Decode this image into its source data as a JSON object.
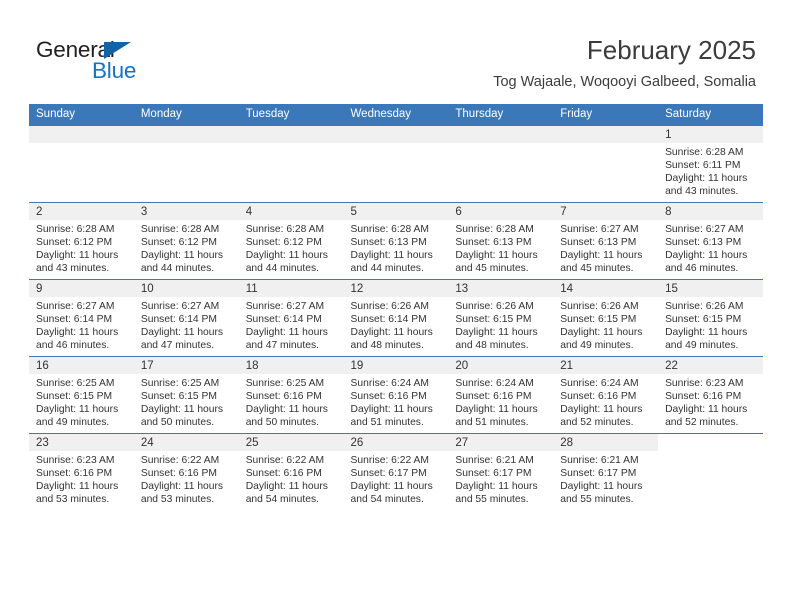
{
  "logo": {
    "word_top": "General",
    "word_bottom": "Blue",
    "triangle_color": "#1464a5",
    "text_color": "#231f20",
    "blue_color": "#1474c4"
  },
  "header": {
    "title": "February 2025",
    "subtitle": "Tog Wajaale, Woqooyi Galbeed, Somalia"
  },
  "theme": {
    "header_blue": "#3b78ba",
    "daynum_band": "#f0f0f0",
    "text": "#333333"
  },
  "weekdays": [
    "Sunday",
    "Monday",
    "Tuesday",
    "Wednesday",
    "Thursday",
    "Friday",
    "Saturday"
  ],
  "weeks": [
    [
      {
        "day": "",
        "blank": true,
        "band": true
      },
      {
        "day": "",
        "blank": true,
        "band": true
      },
      {
        "day": "",
        "blank": true,
        "band": true
      },
      {
        "day": "",
        "blank": true,
        "band": true
      },
      {
        "day": "",
        "blank": true,
        "band": true
      },
      {
        "day": "",
        "blank": true,
        "band": true
      },
      {
        "day": "1",
        "sunrise": "Sunrise: 6:28 AM",
        "sunset": "Sunset: 6:11 PM",
        "daylight_1": "Daylight: 11 hours",
        "daylight_2": "and 43 minutes."
      }
    ],
    [
      {
        "day": "2",
        "sunrise": "Sunrise: 6:28 AM",
        "sunset": "Sunset: 6:12 PM",
        "daylight_1": "Daylight: 11 hours",
        "daylight_2": "and 43 minutes."
      },
      {
        "day": "3",
        "sunrise": "Sunrise: 6:28 AM",
        "sunset": "Sunset: 6:12 PM",
        "daylight_1": "Daylight: 11 hours",
        "daylight_2": "and 44 minutes."
      },
      {
        "day": "4",
        "sunrise": "Sunrise: 6:28 AM",
        "sunset": "Sunset: 6:12 PM",
        "daylight_1": "Daylight: 11 hours",
        "daylight_2": "and 44 minutes."
      },
      {
        "day": "5",
        "sunrise": "Sunrise: 6:28 AM",
        "sunset": "Sunset: 6:13 PM",
        "daylight_1": "Daylight: 11 hours",
        "daylight_2": "and 44 minutes."
      },
      {
        "day": "6",
        "sunrise": "Sunrise: 6:28 AM",
        "sunset": "Sunset: 6:13 PM",
        "daylight_1": "Daylight: 11 hours",
        "daylight_2": "and 45 minutes."
      },
      {
        "day": "7",
        "sunrise": "Sunrise: 6:27 AM",
        "sunset": "Sunset: 6:13 PM",
        "daylight_1": "Daylight: 11 hours",
        "daylight_2": "and 45 minutes."
      },
      {
        "day": "8",
        "sunrise": "Sunrise: 6:27 AM",
        "sunset": "Sunset: 6:13 PM",
        "daylight_1": "Daylight: 11 hours",
        "daylight_2": "and 46 minutes."
      }
    ],
    [
      {
        "day": "9",
        "sunrise": "Sunrise: 6:27 AM",
        "sunset": "Sunset: 6:14 PM",
        "daylight_1": "Daylight: 11 hours",
        "daylight_2": "and 46 minutes."
      },
      {
        "day": "10",
        "sunrise": "Sunrise: 6:27 AM",
        "sunset": "Sunset: 6:14 PM",
        "daylight_1": "Daylight: 11 hours",
        "daylight_2": "and 47 minutes."
      },
      {
        "day": "11",
        "sunrise": "Sunrise: 6:27 AM",
        "sunset": "Sunset: 6:14 PM",
        "daylight_1": "Daylight: 11 hours",
        "daylight_2": "and 47 minutes."
      },
      {
        "day": "12",
        "sunrise": "Sunrise: 6:26 AM",
        "sunset": "Sunset: 6:14 PM",
        "daylight_1": "Daylight: 11 hours",
        "daylight_2": "and 48 minutes."
      },
      {
        "day": "13",
        "sunrise": "Sunrise: 6:26 AM",
        "sunset": "Sunset: 6:15 PM",
        "daylight_1": "Daylight: 11 hours",
        "daylight_2": "and 48 minutes."
      },
      {
        "day": "14",
        "sunrise": "Sunrise: 6:26 AM",
        "sunset": "Sunset: 6:15 PM",
        "daylight_1": "Daylight: 11 hours",
        "daylight_2": "and 49 minutes."
      },
      {
        "day": "15",
        "sunrise": "Sunrise: 6:26 AM",
        "sunset": "Sunset: 6:15 PM",
        "daylight_1": "Daylight: 11 hours",
        "daylight_2": "and 49 minutes."
      }
    ],
    [
      {
        "day": "16",
        "sunrise": "Sunrise: 6:25 AM",
        "sunset": "Sunset: 6:15 PM",
        "daylight_1": "Daylight: 11 hours",
        "daylight_2": "and 49 minutes."
      },
      {
        "day": "17",
        "sunrise": "Sunrise: 6:25 AM",
        "sunset": "Sunset: 6:15 PM",
        "daylight_1": "Daylight: 11 hours",
        "daylight_2": "and 50 minutes."
      },
      {
        "day": "18",
        "sunrise": "Sunrise: 6:25 AM",
        "sunset": "Sunset: 6:16 PM",
        "daylight_1": "Daylight: 11 hours",
        "daylight_2": "and 50 minutes."
      },
      {
        "day": "19",
        "sunrise": "Sunrise: 6:24 AM",
        "sunset": "Sunset: 6:16 PM",
        "daylight_1": "Daylight: 11 hours",
        "daylight_2": "and 51 minutes."
      },
      {
        "day": "20",
        "sunrise": "Sunrise: 6:24 AM",
        "sunset": "Sunset: 6:16 PM",
        "daylight_1": "Daylight: 11 hours",
        "daylight_2": "and 51 minutes."
      },
      {
        "day": "21",
        "sunrise": "Sunrise: 6:24 AM",
        "sunset": "Sunset: 6:16 PM",
        "daylight_1": "Daylight: 11 hours",
        "daylight_2": "and 52 minutes."
      },
      {
        "day": "22",
        "sunrise": "Sunrise: 6:23 AM",
        "sunset": "Sunset: 6:16 PM",
        "daylight_1": "Daylight: 11 hours",
        "daylight_2": "and 52 minutes."
      }
    ],
    [
      {
        "day": "23",
        "sunrise": "Sunrise: 6:23 AM",
        "sunset": "Sunset: 6:16 PM",
        "daylight_1": "Daylight: 11 hours",
        "daylight_2": "and 53 minutes."
      },
      {
        "day": "24",
        "sunrise": "Sunrise: 6:22 AM",
        "sunset": "Sunset: 6:16 PM",
        "daylight_1": "Daylight: 11 hours",
        "daylight_2": "and 53 minutes."
      },
      {
        "day": "25",
        "sunrise": "Sunrise: 6:22 AM",
        "sunset": "Sunset: 6:16 PM",
        "daylight_1": "Daylight: 11 hours",
        "daylight_2": "and 54 minutes."
      },
      {
        "day": "26",
        "sunrise": "Sunrise: 6:22 AM",
        "sunset": "Sunset: 6:17 PM",
        "daylight_1": "Daylight: 11 hours",
        "daylight_2": "and 54 minutes."
      },
      {
        "day": "27",
        "sunrise": "Sunrise: 6:21 AM",
        "sunset": "Sunset: 6:17 PM",
        "daylight_1": "Daylight: 11 hours",
        "daylight_2": "and 55 minutes."
      },
      {
        "day": "28",
        "sunrise": "Sunrise: 6:21 AM",
        "sunset": "Sunset: 6:17 PM",
        "daylight_1": "Daylight: 11 hours",
        "daylight_2": "and 55 minutes."
      },
      {
        "day": "",
        "blank": true,
        "band": false
      }
    ]
  ]
}
